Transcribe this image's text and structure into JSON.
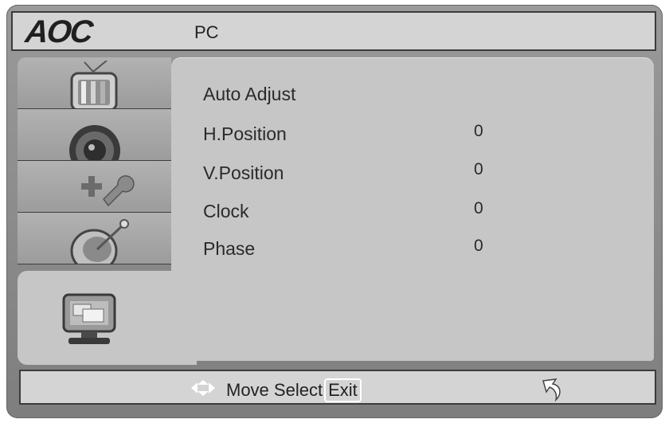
{
  "header": {
    "logo": "AOC",
    "title": "PC"
  },
  "tabs": [
    {
      "icon": "tv-icon"
    },
    {
      "icon": "speaker-icon"
    },
    {
      "icon": "settings-tools-icon"
    },
    {
      "icon": "satellite-dish-icon"
    },
    {
      "icon": "pc-monitor-icon",
      "active": true
    }
  ],
  "menu": {
    "items": [
      {
        "label": "Auto Adjust",
        "value": ""
      },
      {
        "label": "H.Position",
        "value": "0"
      },
      {
        "label": "V.Position",
        "value": "0"
      },
      {
        "label": "Clock",
        "value": "0"
      },
      {
        "label": "Phase",
        "value": "0"
      }
    ]
  },
  "footer": {
    "move_label": "Move",
    "select_label": "Select",
    "exit_label": "Exit",
    "icons": [
      "move-arrows-icon",
      "return-icon"
    ]
  },
  "colors": {
    "frame": "#8a8a8a",
    "panel": "#c6c6c6",
    "header": "#d4d4d4",
    "text": "#2a2a2a"
  }
}
